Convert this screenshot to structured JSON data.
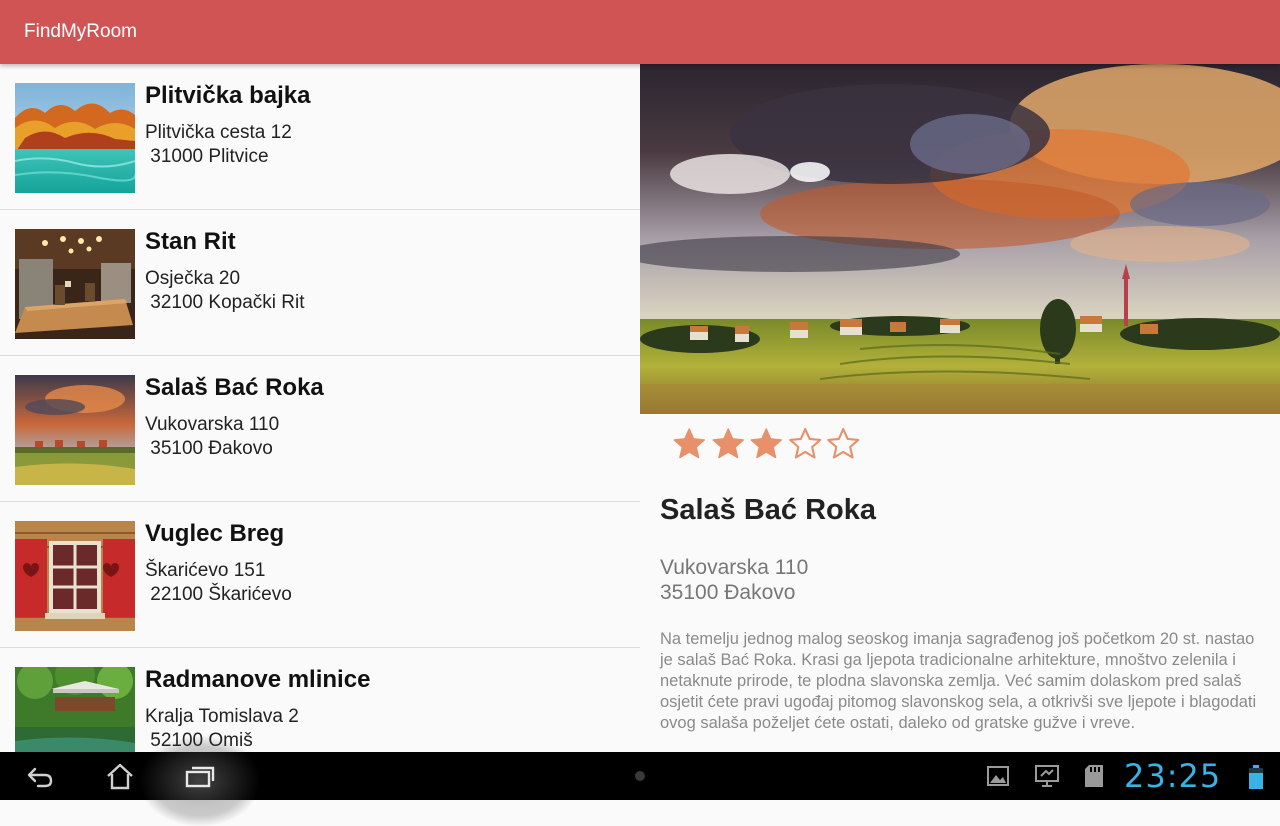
{
  "app": {
    "title": "FindMyRoom"
  },
  "rooms": [
    {
      "name": "Plitvička bajka",
      "address_line1": "Plitvička cesta 12",
      "address_line2": " 31000 Plitvice",
      "thumb": "plitvice-lakes-image"
    },
    {
      "name": "Stan Rit",
      "address_line1": "Osječka 20",
      "address_line2": " 32100 Kopački Rit",
      "thumb": "rustic-dining-room-image"
    },
    {
      "name": "Salaš Bać Roka",
      "address_line1": "Vukovarska 110",
      "address_line2": " 35100 Đakovo",
      "thumb": "sunset-village-image"
    },
    {
      "name": "Vuglec Breg",
      "address_line1": "Škarićevo 151",
      "address_line2": " 22100 Škarićevo",
      "thumb": "red-shutter-window-image"
    },
    {
      "name": "Radmanove mlinice",
      "address_line1": "Kralja Tomislava 2",
      "address_line2": " 52100 Omiš",
      "thumb": "riverside-garden-image"
    }
  ],
  "detail": {
    "title": "Salaš Bać Roka",
    "address_line1": "Vukovarska 110",
    "address_line2": "35100 Đakovo",
    "rating": 3,
    "rating_max": 5,
    "star_color": "#e8906a",
    "description": "Na temelju jednog malog seoskog imanja sagrađenog još početkom 20 st. nastao je salaš Bać Roka. Krasi ga ljepota tradicionalne arhitekture, mnoštvo zelenila i netaknute prirode, te plodna slavonska zemlja. Već samim dolaskom pred salaš osjetit ćete pravi ugođaj pitomog slavonskog sela, a otkrivši sve ljepote i blagodati ovog salaša poželjet ćete ostati, daleko od gratske gužve i vreve."
  },
  "colors": {
    "app_bar": "#d15455",
    "clock": "#39b3e6"
  },
  "system_bar": {
    "clock": "23:25",
    "icons": [
      "back-icon",
      "home-icon",
      "recent-apps-icon",
      "gallery-icon",
      "screen-share-icon",
      "sd-card-icon",
      "battery-icon"
    ]
  }
}
